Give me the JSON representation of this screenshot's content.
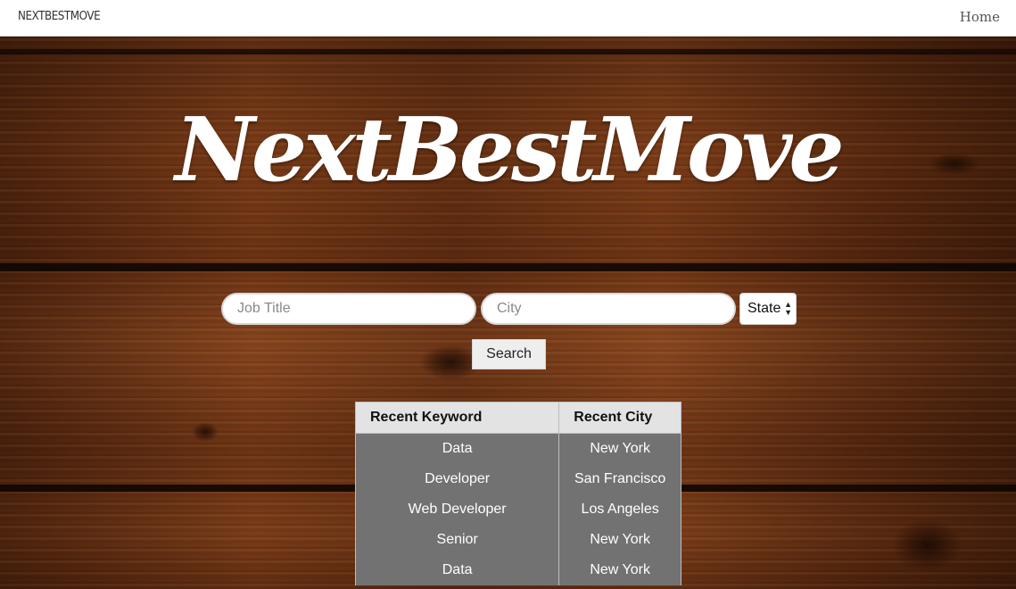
{
  "navbar": {
    "brand": "NEXTBESTMOVE",
    "home_link": "Home"
  },
  "hero": {
    "logo_title": "NextBestMove"
  },
  "search": {
    "job_title_placeholder": "Job Title",
    "city_placeholder": "City",
    "state_selected": "State",
    "search_button": "Search"
  },
  "recent": {
    "headers": {
      "keyword": "Recent Keyword",
      "city": "Recent City"
    },
    "rows": [
      {
        "keyword": "Data",
        "city": "New York"
      },
      {
        "keyword": "Developer",
        "city": "San Francisco"
      },
      {
        "keyword": "Web Developer",
        "city": "Los Angeles"
      },
      {
        "keyword": "Senior",
        "city": "New York"
      },
      {
        "keyword": "Data",
        "city": "New York"
      }
    ]
  }
}
